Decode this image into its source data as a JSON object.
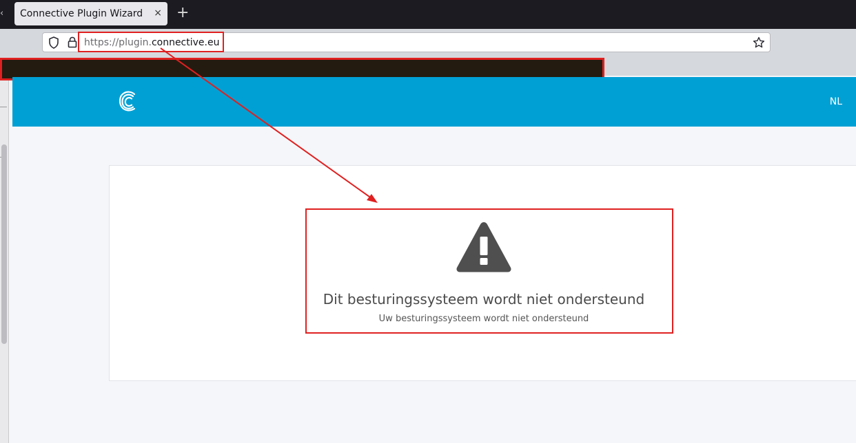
{
  "browser": {
    "tab_title": "Connective Plugin Wizard",
    "tab_close": "×",
    "new_tab": "+",
    "tab_edge_glyph": "‹",
    "url_scheme": "https://plugin.",
    "url_domain": "connective.eu",
    "icons": [
      "shield-icon",
      "lock-icon",
      "bookmark-star-icon"
    ]
  },
  "header": {
    "logo_icon": "connective-logo-icon",
    "language": "NL",
    "bg_color": "#00a0d4"
  },
  "message": {
    "icon": "warning-triangle-icon",
    "title": "Dit besturingssysteem wordt niet ondersteund",
    "subtitle": "Uw besturingssysteem wordt niet ondersteund"
  },
  "annotations": {
    "color": "#e02020"
  }
}
